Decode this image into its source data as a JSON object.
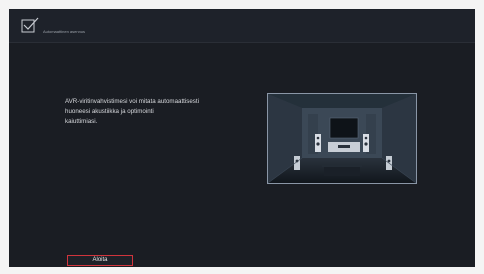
{
  "header": {
    "icon": "checkbox-check-icon",
    "title": "Automaattinen asennus"
  },
  "main": {
    "description_lines": [
      "AVR-viritinvahvistimesi voi mitata automaattisesti",
      "huoneesi akustiikka ja optimointi",
      "kaiuttimiasi."
    ]
  },
  "footer": {
    "start_label": "Aloita"
  },
  "colors": {
    "background": "#1a1d23",
    "accent_border": "#d0343c"
  }
}
